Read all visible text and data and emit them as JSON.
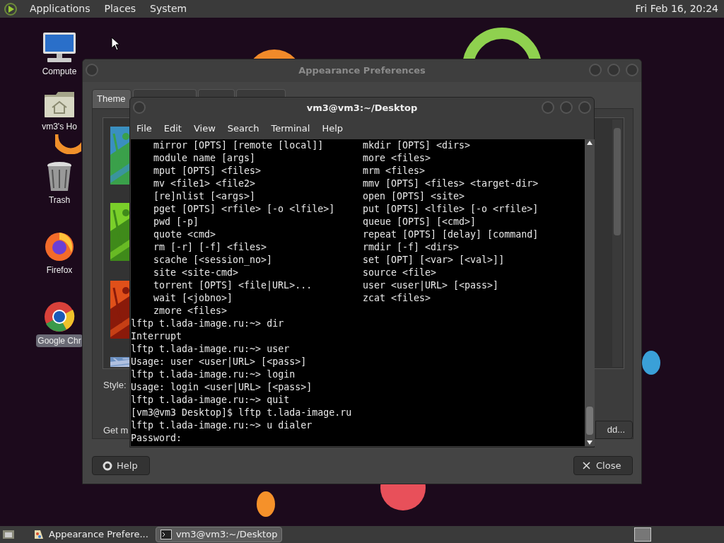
{
  "top_panel": {
    "menus": [
      "Applications",
      "Places",
      "System"
    ],
    "clock": "Fri Feb 16, 20:24"
  },
  "desktop_icons": [
    {
      "label": "Compute",
      "kind": "computer",
      "selected": false
    },
    {
      "label": "vm3's Ho",
      "kind": "home",
      "selected": false
    },
    {
      "label": "Trash",
      "kind": "trash",
      "selected": false
    },
    {
      "label": "Firefox",
      "kind": "firefox",
      "selected": false
    },
    {
      "label": "Google Chr",
      "kind": "chrome",
      "selected": true
    }
  ],
  "appearance_window": {
    "title": "Appearance Preferences",
    "tabs": [
      {
        "label": "Theme",
        "selected": true
      },
      {
        "selected": false
      },
      {
        "selected": false
      },
      {
        "selected": false
      }
    ],
    "style_label": "Style:",
    "get_more_label": "Get m",
    "add_button": "dd...",
    "help_button": "Help",
    "close_button": "Close"
  },
  "terminal": {
    "title": "vm3@vm3:~/Desktop",
    "menus": [
      "File",
      "Edit",
      "View",
      "Search",
      "Terminal",
      "Help"
    ],
    "lines": [
      {
        "kind": "columns",
        "left": "mirror [OPTS] [remote [local]]",
        "right": "mkdir [OPTS] <dirs>"
      },
      {
        "kind": "columns",
        "left": "module name [args]",
        "right": "more <files>"
      },
      {
        "kind": "columns",
        "left": "mput [OPTS] <files>",
        "right": "mrm <files>"
      },
      {
        "kind": "columns",
        "left": "mv <file1> <file2>",
        "right": "mmv [OPTS] <files> <target-dir>"
      },
      {
        "kind": "columns",
        "left": "[re]nlist [<args>]",
        "right": "open [OPTS] <site>"
      },
      {
        "kind": "columns",
        "left": "pget [OPTS] <rfile> [-o <lfile>]",
        "right": "put [OPTS] <lfile> [-o <rfile>]"
      },
      {
        "kind": "columns",
        "left": "pwd [-p]",
        "right": "queue [OPTS] [<cmd>]"
      },
      {
        "kind": "columns",
        "left": "quote <cmd>",
        "right": "repeat [OPTS] [delay] [command]"
      },
      {
        "kind": "columns",
        "left": "rm [-r] [-f] <files>",
        "right": "rmdir [-f] <dirs>"
      },
      {
        "kind": "columns",
        "left": "scache [<session_no>]",
        "right": "set [OPT] [<var> [<val>]]"
      },
      {
        "kind": "columns",
        "left": "site <site-cmd>",
        "right": "source <file>"
      },
      {
        "kind": "columns",
        "left": "torrent [OPTS] <file|URL>...",
        "right": "user <user|URL> [<pass>]"
      },
      {
        "kind": "columns",
        "left": "wait [<jobno>]",
        "right": "zcat <files>"
      },
      {
        "kind": "columns",
        "left": "zmore <files>"
      },
      {
        "kind": "line",
        "text": "lftp t.lada-image.ru:~> dir"
      },
      {
        "kind": "line",
        "text": "Interrupt"
      },
      {
        "kind": "line",
        "text": "lftp t.lada-image.ru:~> user"
      },
      {
        "kind": "line",
        "text": "Usage: user <user|URL> [<pass>]"
      },
      {
        "kind": "line",
        "text": "lftp t.lada-image.ru:~> login"
      },
      {
        "kind": "line",
        "text": "Usage: login <user|URL> [<pass>]"
      },
      {
        "kind": "line",
        "text": "lftp t.lada-image.ru:~> quit"
      },
      {
        "kind": "line",
        "text": "[vm3@vm3 Desktop]$ lftp t.lada-image.ru"
      },
      {
        "kind": "line",
        "text": "lftp t.lada-image.ru:~> u dialer"
      },
      {
        "kind": "line",
        "text": "Password:"
      }
    ]
  },
  "taskbar": {
    "tasks": [
      {
        "label": "Appearance Prefere...",
        "kind": "appearance",
        "selected": false
      },
      {
        "label": "vm3@vm3:~/Desktop",
        "kind": "terminal",
        "selected": true
      }
    ]
  }
}
